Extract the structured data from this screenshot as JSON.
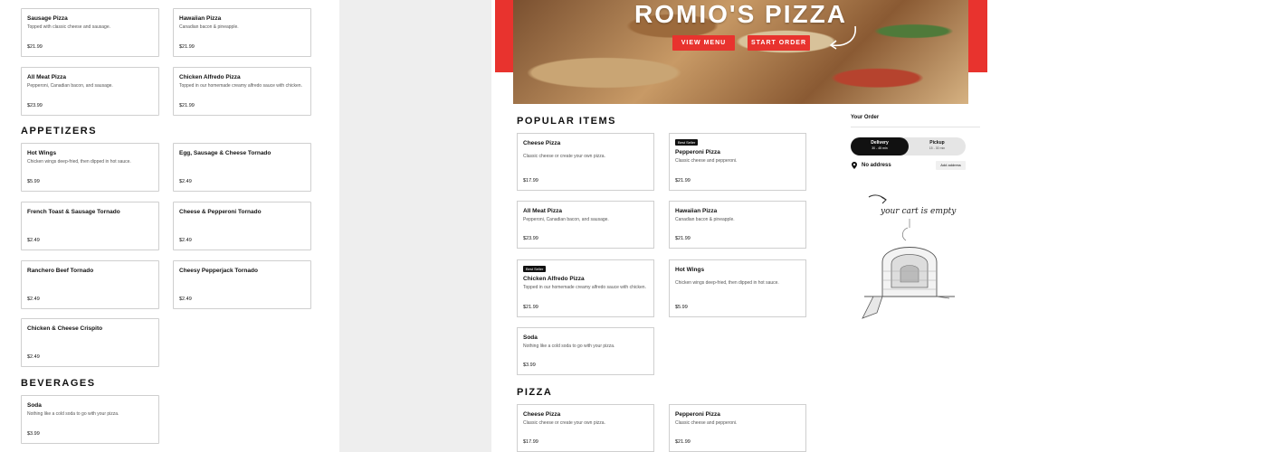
{
  "left": {
    "cards": [
      {
        "title": "Sausage Pizza",
        "desc": "Topped with classic cheese and sausage.",
        "price": "$21.99"
      },
      {
        "title": "Hawaiian Pizza",
        "desc": "Canadian bacon & pineapple.",
        "price": "$21.99"
      },
      {
        "title": "All Meat Pizza",
        "desc": "Pepperoni, Canadian bacon, and sausage.",
        "price": "$23.99"
      },
      {
        "title": "Chicken Alfredo Pizza",
        "desc": "Topped in our homemade creamy alfredo sauce with chicken.",
        "price": "$21.99"
      }
    ],
    "appetizers_heading": "APPETIZERS",
    "appetizers": [
      {
        "title": "Hot Wings",
        "desc": "Chicken wings deep-fried, then dipped in hot sauce.",
        "price": "$5.99"
      },
      {
        "title": "Egg, Sausage & Cheese Tornado",
        "desc": "",
        "price": "$2.49"
      },
      {
        "title": "French Toast & Sausage Tornado",
        "desc": "",
        "price": "$2.49"
      },
      {
        "title": "Cheese & Pepperoni Tornado",
        "desc": "",
        "price": "$2.49"
      },
      {
        "title": "Ranchero Beef Tornado",
        "desc": "",
        "price": "$2.49"
      },
      {
        "title": "Cheesy Pepperjack Tornado",
        "desc": "",
        "price": "$2.49"
      },
      {
        "title": "Chicken & Cheese Crispito",
        "desc": "",
        "price": "$2.49"
      }
    ],
    "beverages_heading": "BEVERAGES",
    "beverages": [
      {
        "title": "Soda",
        "desc": "Nothing like a cold soda to go with your pizza.",
        "price": "$3.99"
      }
    ]
  },
  "hero": {
    "title": "ROMIO'S PIZZA",
    "view_menu": "VIEW MENU",
    "start_order": "START ORDER"
  },
  "popular": {
    "heading": "POPULAR ITEMS",
    "badge": "Best Seller",
    "items": [
      {
        "title": "Cheese Pizza",
        "desc": "Classic cheese or create your own pizza.",
        "price": "$17.99"
      },
      {
        "title": "Pepperoni Pizza",
        "desc": "Classic cheese and pepperoni.",
        "price": "$21.99"
      },
      {
        "title": "All Meat Pizza",
        "desc": "Pepperoni, Canadian bacon, and sausage.",
        "price": "$23.99"
      },
      {
        "title": "Hawaiian Pizza",
        "desc": "Canadian bacon & pineapple.",
        "price": "$21.99"
      },
      {
        "title": "Chicken Alfredo Pizza",
        "desc": "Topped in our homemade creamy alfredo sauce with chicken.",
        "price": "$21.99"
      },
      {
        "title": "Hot Wings",
        "desc": "Chicken wings deep-fried, then dipped in hot sauce.",
        "price": "$5.99"
      },
      {
        "title": "Soda",
        "desc": "Nothing like a cold soda to go with your pizza.",
        "price": "$3.99"
      }
    ]
  },
  "pizza": {
    "heading": "PIZZA",
    "items": [
      {
        "title": "Cheese Pizza",
        "desc": "Classic cheese or create your own pizza.",
        "price": "$17.99"
      },
      {
        "title": "Pepperoni Pizza",
        "desc": "Classic cheese and pepperoni.",
        "price": "$21.99"
      }
    ]
  },
  "order": {
    "title": "Your Order",
    "delivery_label": "Delivery",
    "delivery_time": "30 - 45 min",
    "pickup_label": "Pickup",
    "pickup_time": "15 - 30 min",
    "no_address": "No address",
    "add_address": "Add address",
    "cart_empty": "your cart is empty"
  },
  "colors": {
    "brand_red": "#e8332e",
    "dark": "#111111"
  }
}
